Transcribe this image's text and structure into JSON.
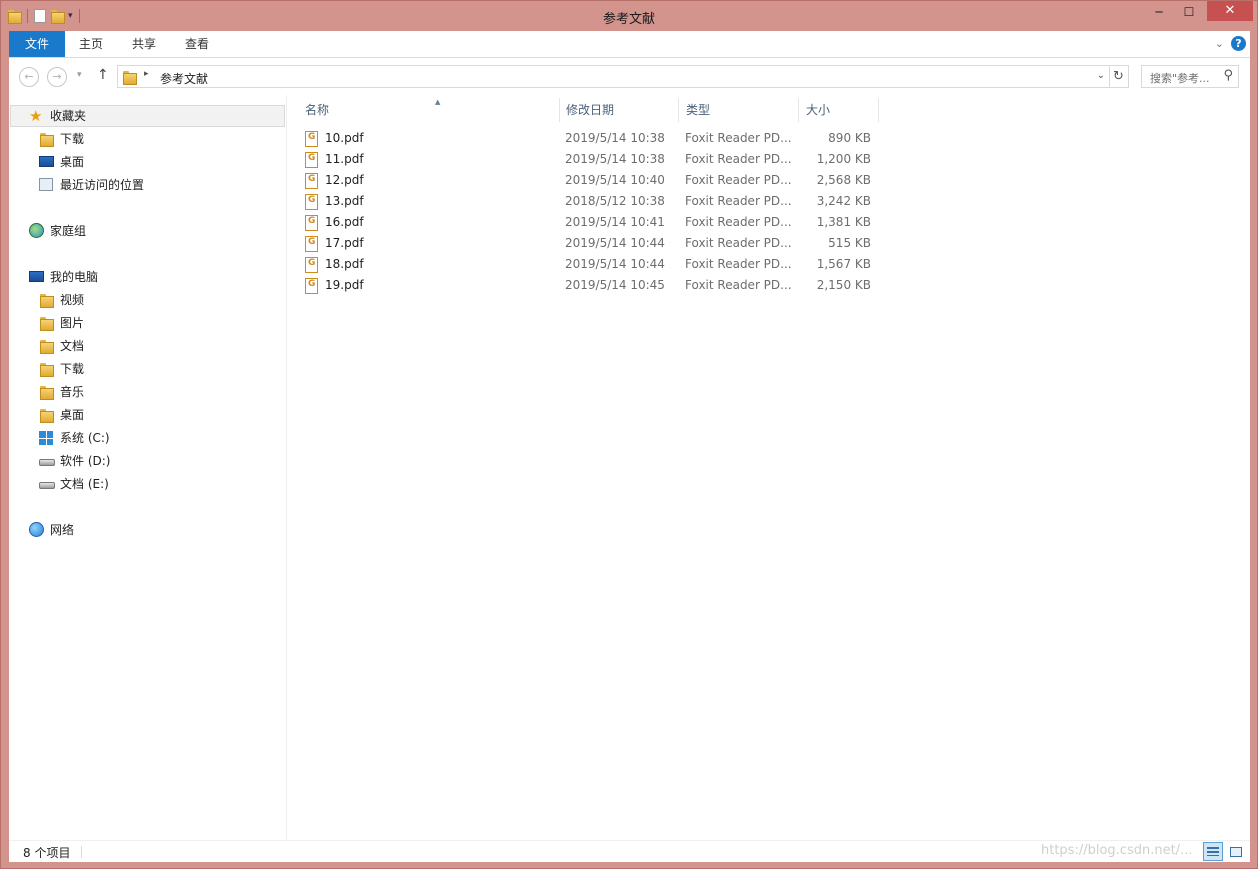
{
  "window": {
    "title": "参考文献",
    "minimize_glyph": "─",
    "maximize_glyph": "☐",
    "close_glyph": "✕",
    "frame_color": "#d3948e"
  },
  "ribbon": {
    "tabs": [
      {
        "label": "文件"
      },
      {
        "label": "主页"
      },
      {
        "label": "共享"
      },
      {
        "label": "查看"
      }
    ],
    "accent": "#1979ca",
    "expand_glyph": "⌄",
    "help_glyph": "?"
  },
  "address": {
    "back_glyph": "←",
    "forward_glyph": "→",
    "recent_glyph": "▾",
    "up_glyph": "↑",
    "separator_glyph": "▸",
    "path": "参考文献",
    "dropdown_glyph": "⌄",
    "refresh_glyph": "↻",
    "search_placeholder": "搜索\"参考...",
    "search_glyph": "⚲"
  },
  "nav": {
    "favorites": {
      "label": "收藏夹",
      "icon": "star-icon"
    },
    "favorites_items": [
      {
        "label": "下载",
        "icon": "downloads-folder-icon"
      },
      {
        "label": "桌面",
        "icon": "desktop-icon"
      },
      {
        "label": "最近访问的位置",
        "icon": "recent-places-icon"
      }
    ],
    "homegroup": {
      "label": "家庭组",
      "icon": "homegroup-icon"
    },
    "computer": {
      "label": "我的电脑",
      "icon": "computer-icon"
    },
    "computer_items": [
      {
        "label": "视频",
        "icon": "videos-folder-icon"
      },
      {
        "label": "图片",
        "icon": "pictures-folder-icon"
      },
      {
        "label": "文档",
        "icon": "documents-folder-icon"
      },
      {
        "label": "下载",
        "icon": "downloads-folder-icon"
      },
      {
        "label": "音乐",
        "icon": "music-folder-icon"
      },
      {
        "label": "桌面",
        "icon": "desktop-folder-icon"
      },
      {
        "label": "系统 (C:)",
        "icon": "system-drive-icon"
      },
      {
        "label": "软件 (D:)",
        "icon": "drive-icon"
      },
      {
        "label": "文档 (E:)",
        "icon": "drive-icon"
      }
    ],
    "network": {
      "label": "网络",
      "icon": "network-icon"
    }
  },
  "columns": {
    "name": "名称",
    "date": "修改日期",
    "type": "类型",
    "size": "大小",
    "sort_glyph": "▲"
  },
  "files": [
    {
      "name": "10.pdf",
      "date": "2019/5/14 10:38",
      "type": "Foxit Reader PD...",
      "size": "890 KB"
    },
    {
      "name": "11.pdf",
      "date": "2019/5/14 10:38",
      "type": "Foxit Reader PD...",
      "size": "1,200 KB"
    },
    {
      "name": "12.pdf",
      "date": "2019/5/14 10:40",
      "type": "Foxit Reader PD...",
      "size": "2,568 KB"
    },
    {
      "name": "13.pdf",
      "date": "2018/5/12 10:38",
      "type": "Foxit Reader PD...",
      "size": "3,242 KB"
    },
    {
      "name": "16.pdf",
      "date": "2019/5/14 10:41",
      "type": "Foxit Reader PD...",
      "size": "1,381 KB"
    },
    {
      "name": "17.pdf",
      "date": "2019/5/14 10:44",
      "type": "Foxit Reader PD...",
      "size": "515 KB"
    },
    {
      "name": "18.pdf",
      "date": "2019/5/14 10:44",
      "type": "Foxit Reader PD...",
      "size": "1,567 KB"
    },
    {
      "name": "19.pdf",
      "date": "2019/5/14 10:45",
      "type": "Foxit Reader PD...",
      "size": "2,150 KB"
    }
  ],
  "status": {
    "item_count": "8 个项目"
  },
  "watermark": "https://blog.csdn.net/..."
}
